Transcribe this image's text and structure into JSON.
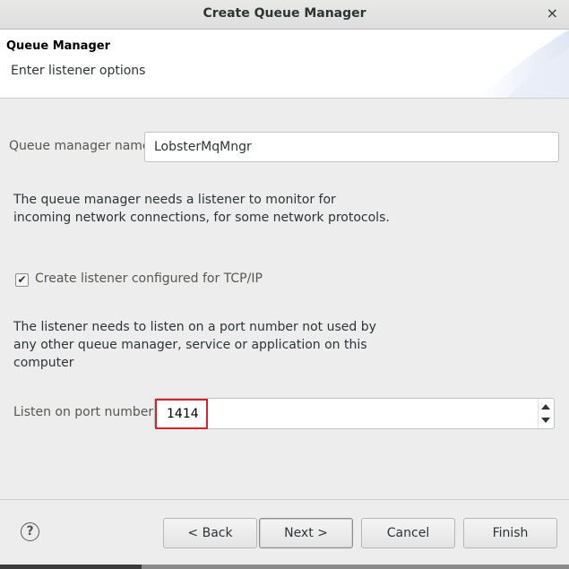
{
  "window": {
    "title": "Create Queue Manager",
    "close_glyph": "×"
  },
  "header": {
    "title": "Queue Manager",
    "subtitle": "Enter listener options"
  },
  "form": {
    "qm_name_label": "Queue manager name:",
    "qm_name_value": "LobsterMqMngr",
    "listener_info": "The queue manager needs a listener to monitor for incoming network connections, for some network protocols.",
    "create_listener_label": "Create listener configured for TCP/IP",
    "create_listener_checked": true,
    "check_glyph": "✔",
    "port_info": "The listener needs to listen on a port number not used by any other queue manager, service or application on this computer",
    "port_label": "Listen on port number:",
    "port_value": "1414"
  },
  "footer": {
    "help_glyph": "?",
    "back_label": "< Back",
    "next_label": "Next >",
    "cancel_label": "Cancel",
    "finish_label": "Finish"
  },
  "colors": {
    "highlight": "#d9232c",
    "background": "#ededed"
  }
}
